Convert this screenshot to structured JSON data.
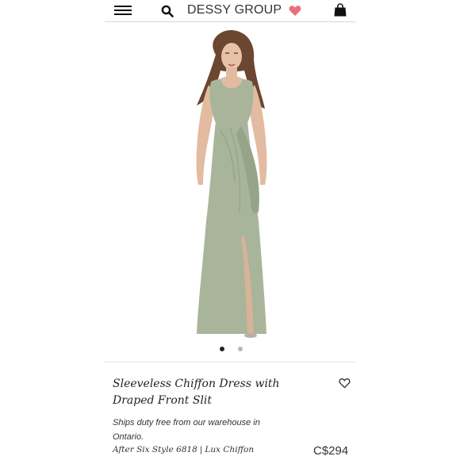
{
  "header": {
    "brand": "DESSY GROUP",
    "icons": [
      "menu-icon",
      "search-icon",
      "heart-icon",
      "shopping-bag-icon"
    ],
    "colors": {
      "heart": "#e8707a",
      "text": "#222222"
    }
  },
  "gallery": {
    "image": "green-sleeveless-chiffon-gown-model",
    "slide_count": 2,
    "active_slide": 1
  },
  "product": {
    "title": "Sleeveless Chiffon Dress with Draped Front Slit",
    "shipping_note": "Ships duty free from our warehouse in Ontario.",
    "style": "After Six Style 6818",
    "separator": "|",
    "fabric": "Lux Chiffon",
    "price": "C$294",
    "dress_color": "#a8b59a"
  }
}
